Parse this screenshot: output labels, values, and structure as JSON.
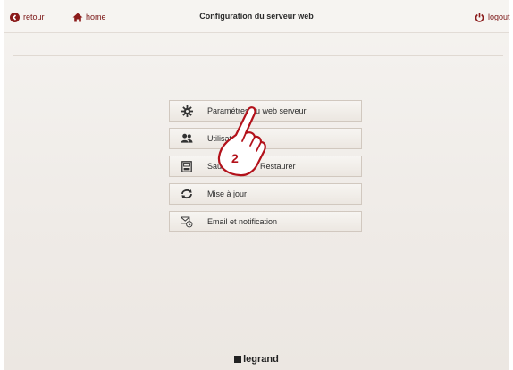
{
  "header": {
    "back_label": "retour",
    "home_label": "home",
    "title": "Configuration du serveur web",
    "logout_label": "logout"
  },
  "menu": {
    "items": [
      {
        "label": "Paramétres du web serveur",
        "icon": "gear-icon"
      },
      {
        "label": "Utilisateurs",
        "icon": "users-icon"
      },
      {
        "label": "Sauvegarder / Restaurer",
        "icon": "save-restore-icon"
      },
      {
        "label": "Mise à jour",
        "icon": "update-icon"
      },
      {
        "label": "Email et notification",
        "icon": "email-notification-icon"
      }
    ]
  },
  "overlay": {
    "step_number": "2"
  },
  "footer": {
    "brand": "legrand"
  },
  "colors": {
    "accent": "#7a1414",
    "background": "#f2efeb",
    "button_border": "#d1c8bf",
    "hand_outline": "#b3121b"
  }
}
